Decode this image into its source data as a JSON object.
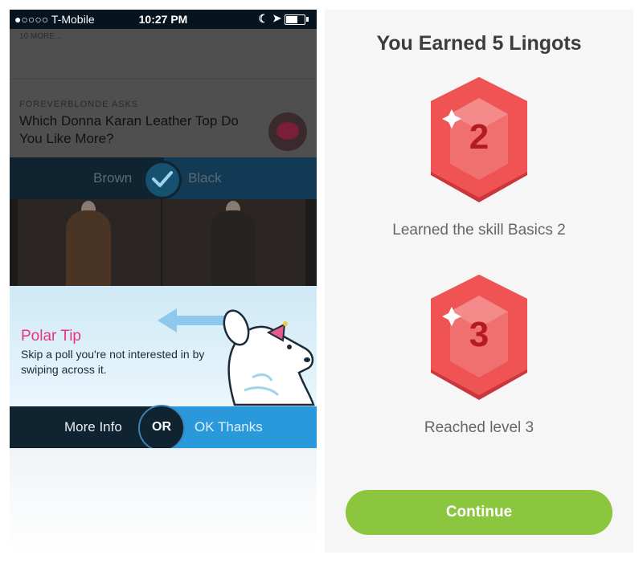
{
  "left": {
    "status_bar": {
      "carrier": "●○○○○ T-Mobile",
      "time": "10:27 PM"
    },
    "feed": {
      "more_link": "10 MORE...",
      "asker": "FOREVERBLONDE ASKS",
      "question": "Which Donna Karan Leather Top Do You Like More?",
      "option_left": "Brown",
      "option_right": "Black"
    },
    "tip": {
      "title": "Polar Tip",
      "body": "Skip a poll you're not interested in by swiping across it."
    },
    "actions": {
      "more_info": "More Info",
      "or": "OR",
      "ok": "OK Thanks"
    }
  },
  "right": {
    "title": "You Earned 5 Lingots",
    "rewards": [
      {
        "number": "2",
        "caption": "Learned the skill Basics 2"
      },
      {
        "number": "3",
        "caption": "Reached level 3"
      }
    ],
    "continue_label": "Continue"
  },
  "colors": {
    "accent_pink": "#e8357d",
    "continue_green": "#8cc63f",
    "gem_red": "#e8474a"
  }
}
